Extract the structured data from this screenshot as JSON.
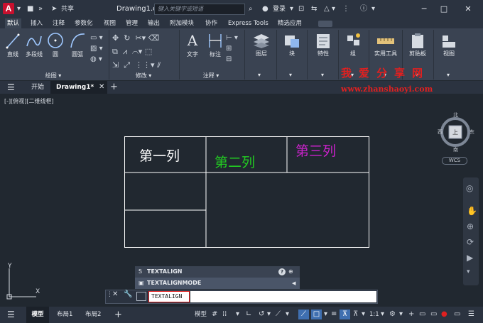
{
  "app": {
    "share_label": "共享",
    "document_title": "Drawing1.dwg",
    "search_placeholder": "键入关键字或短语",
    "login_label": "登录"
  },
  "ribbon_tabs": [
    "默认",
    "插入",
    "注释",
    "参数化",
    "视图",
    "管理",
    "输出",
    "附加模块",
    "协作",
    "Express Tools",
    "精选应用"
  ],
  "panels": {
    "draw": {
      "label": "绘图",
      "tools": [
        "直线",
        "多段线",
        "圆",
        "圆弧"
      ]
    },
    "modify": {
      "label": "修改"
    },
    "annotation": {
      "label": "注释",
      "tools": [
        "文字",
        "标注"
      ]
    },
    "layers": {
      "label": "图层"
    },
    "block": {
      "label": "块"
    },
    "properties": {
      "label": "特性"
    },
    "groups": {
      "label": "组"
    },
    "utilities": {
      "label": "实用工具"
    },
    "clipboard": {
      "label": "剪贴板"
    },
    "view": {
      "label": "视图"
    }
  },
  "doc_tabs": {
    "start": "开始",
    "drawing": "Drawing1*"
  },
  "viewport": {
    "label": "[-][俯视][二维线框]"
  },
  "table_cells": [
    {
      "text": "第一列",
      "color": "#ffffff"
    },
    {
      "text": "第二列",
      "color": "#22cc22"
    },
    {
      "text": "第三列",
      "color": "#cc22cc"
    }
  ],
  "watermark": {
    "title": "我爱分享网",
    "url": "www.zhanshaoyi.com",
    "color": "#e02020"
  },
  "compass": {
    "north": "北",
    "south": "南",
    "west": "西",
    "east": "东",
    "top": "上",
    "wcs": "WCS"
  },
  "command": {
    "suggestions": [
      "TEXTALIGN",
      "TEXTALIGNMODE"
    ],
    "input_value": "TEXTALIGN"
  },
  "ucs": {
    "x": "X",
    "y": "Y"
  },
  "status": {
    "model_tab": "模型",
    "layout1": "布局1",
    "layout2": "布局2",
    "model_button": "模型",
    "scale": "1:1"
  },
  "colors": {
    "accent_blue": "#3f6fb0",
    "brand_red": "#c8102e"
  }
}
